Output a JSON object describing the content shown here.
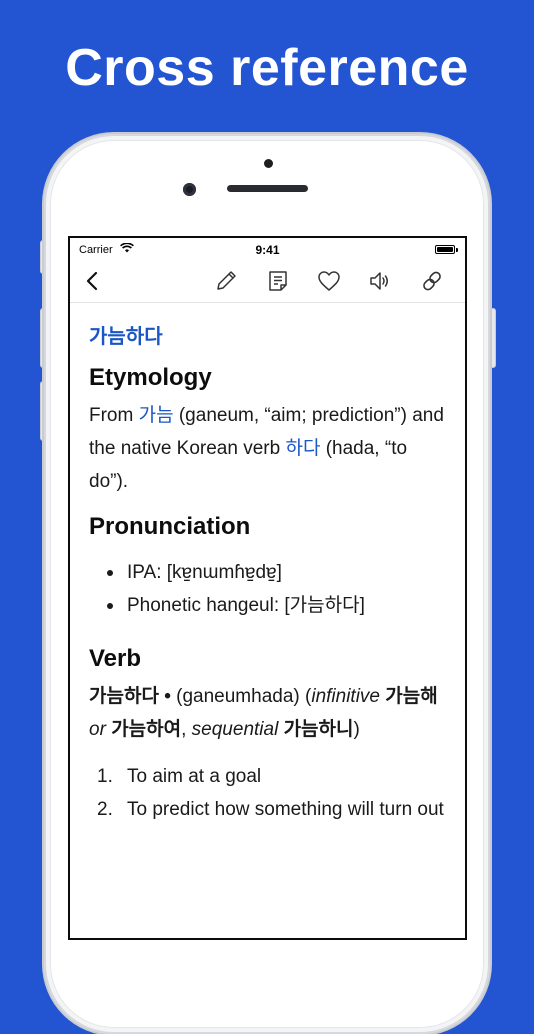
{
  "headline": "Cross reference",
  "status": {
    "carrier": "Carrier",
    "time": "9:41"
  },
  "toolbar": {
    "icons": [
      "chevron-left-icon",
      "pencil-icon",
      "note-icon",
      "heart-icon",
      "speaker-icon",
      "link-icon"
    ]
  },
  "entry": {
    "title": "가늠하다",
    "etymology": {
      "heading": "Etymology",
      "from_prefix": "From ",
      "from_link": "가늠",
      "from_rest": " (ganeum, “aim; prediction”) and the native Korean verb ",
      "verb_link": "하다",
      "verb_rest": " (hada, “to do”)."
    },
    "pronunciation": {
      "heading": "Pronunciation",
      "items": [
        "IPA: [kɐ̠nɯmɦɐ̠dɐ̠]",
        "Phonetic hangeul: [가늠하다]"
      ]
    },
    "verb": {
      "heading": "Verb",
      "headword": "가늠하다",
      "bullet": " • ",
      "romanization": "(ganeumhada) (",
      "inf_label": "infinitive",
      "inf_form": " 가늠해",
      "or_label": " or ",
      "inf_form2": "가늠하여",
      "comma": ", ",
      "seq_label": "sequential",
      "seq_form": " 가늠하니",
      "close": ")",
      "definitions": [
        {
          "num": "1.",
          "text": "To aim at a goal"
        },
        {
          "num": "2.",
          "text": "To predict how something will turn out"
        }
      ]
    }
  },
  "colors": {
    "background": "#2355d3",
    "link": "#1a56c4"
  }
}
